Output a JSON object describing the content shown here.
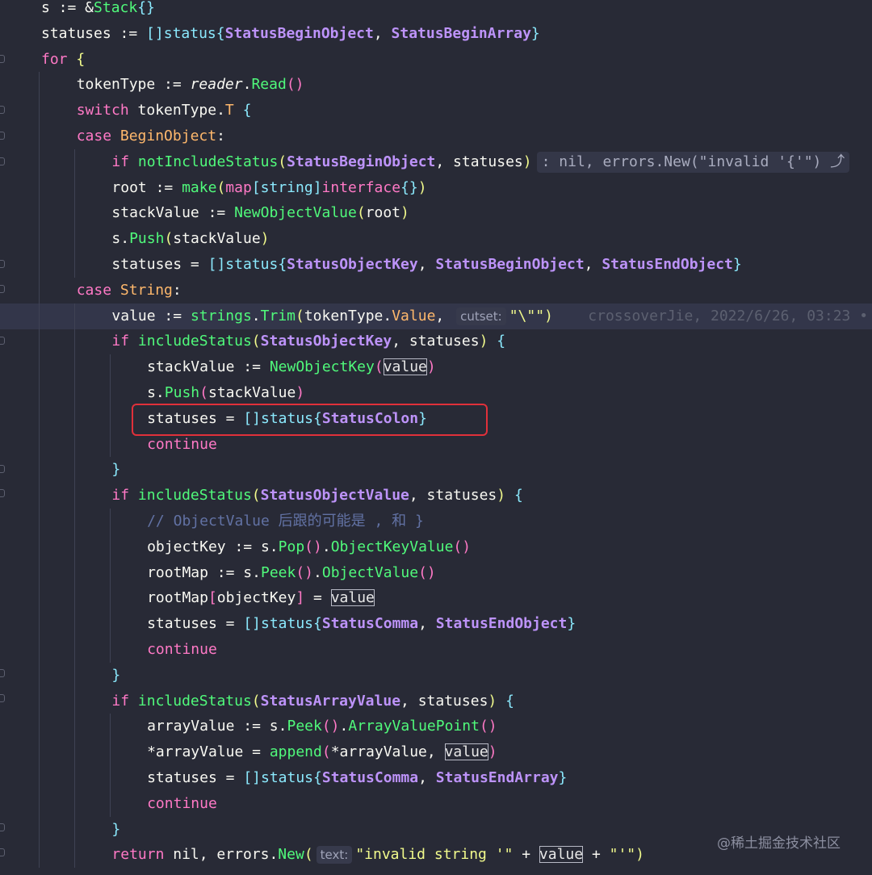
{
  "editor": {
    "lines": [
      {
        "indent": 0,
        "tokens": [
          [
            "id",
            "s := &"
          ],
          [
            "fn",
            "Stack"
          ],
          [
            "br3",
            "{}"
          ]
        ]
      },
      {
        "indent": 0,
        "tokens": [
          [
            "id",
            "statuses := "
          ],
          [
            "br3",
            "[]"
          ],
          [
            "ty",
            "status"
          ],
          [
            "br3",
            "{"
          ],
          [
            "const",
            "StatusBeginObject"
          ],
          [
            "id",
            ", "
          ],
          [
            "const",
            "StatusBeginArray"
          ],
          [
            "br3",
            "}"
          ]
        ]
      },
      {
        "indent": 0,
        "tokens": [
          [
            "kw",
            "for "
          ],
          [
            "br1",
            "{"
          ]
        ]
      },
      {
        "indent": 1,
        "tokens": [
          [
            "id",
            "tokenType := "
          ],
          [
            "it",
            "reader"
          ],
          [
            "id",
            "."
          ],
          [
            "fn",
            "Read"
          ],
          [
            "br2",
            "()"
          ]
        ]
      },
      {
        "indent": 1,
        "tokens": [
          [
            "kw",
            "switch "
          ],
          [
            "id",
            "tokenType."
          ],
          [
            "fld",
            "T"
          ],
          [
            "id",
            " "
          ],
          [
            "br3",
            "{"
          ]
        ]
      },
      {
        "indent": 1,
        "tokens": [
          [
            "kw",
            "case "
          ],
          [
            "fld",
            "BeginObject"
          ],
          [
            "id",
            ":"
          ]
        ]
      },
      {
        "indent": 2,
        "tokens": [
          [
            "kw",
            "if "
          ],
          [
            "fn",
            "notIncludeStatus"
          ],
          [
            "br1",
            "("
          ],
          [
            "const",
            "StatusBeginObject"
          ],
          [
            "id",
            ", statuses"
          ],
          [
            "br1",
            ")"
          ],
          [
            "inlay",
            ": nil, errors.New(\"invalid '{'\") ⤴"
          ]
        ]
      },
      {
        "indent": 2,
        "tokens": [
          [
            "id",
            "root := "
          ],
          [
            "fn",
            "make"
          ],
          [
            "br1",
            "("
          ],
          [
            "kw",
            "map"
          ],
          [
            "br3",
            "["
          ],
          [
            "ty",
            "string"
          ],
          [
            "br3",
            "]"
          ],
          [
            "kw",
            "interface"
          ],
          [
            "br3",
            "{}"
          ],
          [
            "br1",
            ")"
          ]
        ]
      },
      {
        "indent": 2,
        "tokens": [
          [
            "id",
            "stackValue := "
          ],
          [
            "fn",
            "NewObjectValue"
          ],
          [
            "br1",
            "("
          ],
          [
            "id",
            "root"
          ],
          [
            "br1",
            ")"
          ]
        ]
      },
      {
        "indent": 2,
        "tokens": [
          [
            "id",
            "s."
          ],
          [
            "fn",
            "Push"
          ],
          [
            "br1",
            "("
          ],
          [
            "id",
            "stackValue"
          ],
          [
            "br1",
            ")"
          ]
        ]
      },
      {
        "indent": 2,
        "tokens": [
          [
            "id",
            "statuses = "
          ],
          [
            "br3",
            "[]"
          ],
          [
            "ty",
            "status"
          ],
          [
            "br3",
            "{"
          ],
          [
            "const",
            "StatusObjectKey"
          ],
          [
            "id",
            ", "
          ],
          [
            "const",
            "StatusBeginObject"
          ],
          [
            "id",
            ", "
          ],
          [
            "const",
            "StatusEndObject"
          ],
          [
            "br3",
            "}"
          ]
        ]
      },
      {
        "indent": 1,
        "tokens": [
          [
            "kw",
            "case "
          ],
          [
            "fld",
            "String"
          ],
          [
            "id",
            ":"
          ]
        ]
      },
      {
        "indent": 2,
        "current": true,
        "tokens": [
          [
            "id",
            "value := "
          ],
          [
            "fn",
            "strings"
          ],
          [
            "id",
            "."
          ],
          [
            "fn",
            "Trim"
          ],
          [
            "br1",
            "("
          ],
          [
            "id",
            "tokenType."
          ],
          [
            "fld",
            "Value"
          ],
          [
            "id",
            ", "
          ],
          [
            "hint",
            "cutset:"
          ],
          [
            "str",
            "\"\\\"\""
          ],
          [
            "br1",
            ")"
          ],
          [
            "blame",
            "    crossoverJie, 2022/6/26, 03:23 •"
          ]
        ]
      },
      {
        "indent": 2,
        "tokens": [
          [
            "kw",
            "if "
          ],
          [
            "fn",
            "includeStatus"
          ],
          [
            "br1",
            "("
          ],
          [
            "const",
            "StatusObjectKey"
          ],
          [
            "id",
            ", statuses"
          ],
          [
            "br1",
            ")"
          ],
          [
            "id",
            " "
          ],
          [
            "br3",
            "{"
          ]
        ]
      },
      {
        "indent": 3,
        "tokens": [
          [
            "id",
            "stackValue := "
          ],
          [
            "fn",
            "NewObjectKey"
          ],
          [
            "br2",
            "("
          ],
          [
            "boxed",
            "value"
          ],
          [
            "br2",
            ")"
          ]
        ]
      },
      {
        "indent": 3,
        "tokens": [
          [
            "id",
            "s."
          ],
          [
            "fn",
            "Push"
          ],
          [
            "br2",
            "("
          ],
          [
            "id",
            "stackValue"
          ],
          [
            "br2",
            ")"
          ]
        ]
      },
      {
        "indent": 3,
        "tokens": [
          [
            "id",
            "statuses = "
          ],
          [
            "br3",
            "[]"
          ],
          [
            "ty",
            "status"
          ],
          [
            "br3",
            "{"
          ],
          [
            "const",
            "StatusColon"
          ],
          [
            "br3",
            "}"
          ]
        ]
      },
      {
        "indent": 3,
        "tokens": [
          [
            "kw",
            "continue"
          ]
        ]
      },
      {
        "indent": 2,
        "tokens": [
          [
            "br3",
            "}"
          ]
        ]
      },
      {
        "indent": 2,
        "tokens": [
          [
            "kw",
            "if "
          ],
          [
            "fn",
            "includeStatus"
          ],
          [
            "br1",
            "("
          ],
          [
            "const",
            "StatusObjectValue"
          ],
          [
            "id",
            ", statuses"
          ],
          [
            "br1",
            ")"
          ],
          [
            "id",
            " "
          ],
          [
            "br3",
            "{"
          ]
        ]
      },
      {
        "indent": 3,
        "tokens": [
          [
            "cm",
            "// ObjectValue 后跟的可能是 , 和 }"
          ]
        ]
      },
      {
        "indent": 3,
        "tokens": [
          [
            "id",
            "objectKey := s."
          ],
          [
            "fn",
            "Pop"
          ],
          [
            "br2",
            "()"
          ],
          [
            "id",
            "."
          ],
          [
            "fn",
            "ObjectKeyValue"
          ],
          [
            "br2",
            "()"
          ]
        ]
      },
      {
        "indent": 3,
        "tokens": [
          [
            "id",
            "rootMap := s."
          ],
          [
            "fn",
            "Peek"
          ],
          [
            "br2",
            "()"
          ],
          [
            "id",
            "."
          ],
          [
            "fn",
            "ObjectValue"
          ],
          [
            "br2",
            "()"
          ]
        ]
      },
      {
        "indent": 3,
        "tokens": [
          [
            "id",
            "rootMap"
          ],
          [
            "br2",
            "["
          ],
          [
            "id",
            "objectKey"
          ],
          [
            "br2",
            "]"
          ],
          [
            "id",
            " = "
          ],
          [
            "boxed",
            "value"
          ]
        ]
      },
      {
        "indent": 3,
        "tokens": [
          [
            "id",
            "statuses = "
          ],
          [
            "br3",
            "[]"
          ],
          [
            "ty",
            "status"
          ],
          [
            "br3",
            "{"
          ],
          [
            "const",
            "StatusComma"
          ],
          [
            "id",
            ", "
          ],
          [
            "const",
            "StatusEndObject"
          ],
          [
            "br3",
            "}"
          ]
        ]
      },
      {
        "indent": 3,
        "tokens": [
          [
            "kw",
            "continue"
          ]
        ]
      },
      {
        "indent": 2,
        "tokens": [
          [
            "br3",
            "}"
          ]
        ]
      },
      {
        "indent": 2,
        "tokens": [
          [
            "kw",
            "if "
          ],
          [
            "fn",
            "includeStatus"
          ],
          [
            "br1",
            "("
          ],
          [
            "const",
            "StatusArrayValue"
          ],
          [
            "id",
            ", statuses"
          ],
          [
            "br1",
            ")"
          ],
          [
            "id",
            " "
          ],
          [
            "br3",
            "{"
          ]
        ]
      },
      {
        "indent": 3,
        "tokens": [
          [
            "id",
            "arrayValue := s."
          ],
          [
            "fn",
            "Peek"
          ],
          [
            "br2",
            "()"
          ],
          [
            "id",
            "."
          ],
          [
            "fn",
            "ArrayValuePoint"
          ],
          [
            "br2",
            "()"
          ]
        ]
      },
      {
        "indent": 3,
        "tokens": [
          [
            "id",
            "*arrayValue = "
          ],
          [
            "fn",
            "append"
          ],
          [
            "br2",
            "("
          ],
          [
            "id",
            "*arrayValue, "
          ],
          [
            "boxed",
            "value"
          ],
          [
            "br2",
            ")"
          ]
        ]
      },
      {
        "indent": 3,
        "tokens": [
          [
            "id",
            "statuses = "
          ],
          [
            "br3",
            "[]"
          ],
          [
            "ty",
            "status"
          ],
          [
            "br3",
            "{"
          ],
          [
            "const",
            "StatusComma"
          ],
          [
            "id",
            ", "
          ],
          [
            "const",
            "StatusEndArray"
          ],
          [
            "br3",
            "}"
          ]
        ]
      },
      {
        "indent": 3,
        "tokens": [
          [
            "kw",
            "continue"
          ]
        ]
      },
      {
        "indent": 2,
        "tokens": [
          [
            "br3",
            "}"
          ]
        ]
      },
      {
        "indent": 2,
        "tokens": [
          [
            "kw",
            "return "
          ],
          [
            "id",
            "nil, errors."
          ],
          [
            "fn",
            "New"
          ],
          [
            "br1",
            "("
          ],
          [
            "hint",
            "text:"
          ],
          [
            "str",
            "\"invalid string '\""
          ],
          [
            "id",
            " + "
          ],
          [
            "boxed",
            "value"
          ],
          [
            "id",
            " + "
          ],
          [
            "str",
            "\"'\""
          ],
          [
            "br1",
            ")"
          ]
        ]
      }
    ]
  },
  "watermark": "@稀土掘金技术社区",
  "colors": {
    "background": "#282a36",
    "highlight_box": "#e0303a",
    "current_line": "#33364a"
  }
}
